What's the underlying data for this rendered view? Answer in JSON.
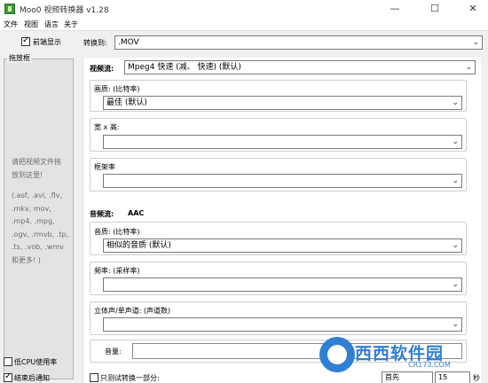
{
  "window": {
    "title": "Moo0 视频转换器 v1.28",
    "minimize": "—",
    "maximize": "☐",
    "close": "✕"
  },
  "menu": [
    "文件",
    "视图",
    "语言",
    "关于"
  ],
  "left": {
    "preview_label": "前端显示",
    "preview_checked": true,
    "dropbox_title": "拖放框",
    "drop_hint_1": "请把视频文件拖",
    "drop_hint_2": "放到这里!",
    "extensions": [
      ".asf, .avi, .flv,",
      ".mkv, mov,",
      ".mp4, .mpg,",
      ".ogv, .rmvb, .tp,",
      ".ts, .vob, .wmv",
      "和更多! )"
    ],
    "ext_prefix": "(",
    "low_cpu_label": "低CPU使用率",
    "low_cpu_checked": false,
    "notify_label": "结束后通知",
    "notify_checked": true
  },
  "main": {
    "convert_to_label": "转换到:",
    "convert_to_value": ".MOV",
    "video": {
      "section_label": "视频流:",
      "codec_value": "Mpeg4  快速        (减、   快速)   (默认)",
      "quality_label": "画质:   (比特率)",
      "quality_value": "最佳  (默认)",
      "size_label": "宽 x 高:",
      "size_value": "",
      "framerate_label": "框架率",
      "framerate_value": ""
    },
    "audio": {
      "section_label": "音频流:",
      "codec_name": "AAC",
      "quality_label": "音质:   (比特率)",
      "quality_value": "相似的音质  (默认)",
      "freq_label": "频率:     (采样率)",
      "freq_value": "",
      "channels_label": "立体声/单声道:     (声道数)",
      "channels_value": "",
      "volume_label": "音量:"
    },
    "partial": {
      "checkbox_label": "只测试转换一部分:",
      "checked": false,
      "from_value": "首先",
      "seconds_value": "15",
      "seconds_unit": "秒"
    }
  },
  "watermark": {
    "logo_text": "西西软件园",
    "url_text": "CR173.COM"
  }
}
